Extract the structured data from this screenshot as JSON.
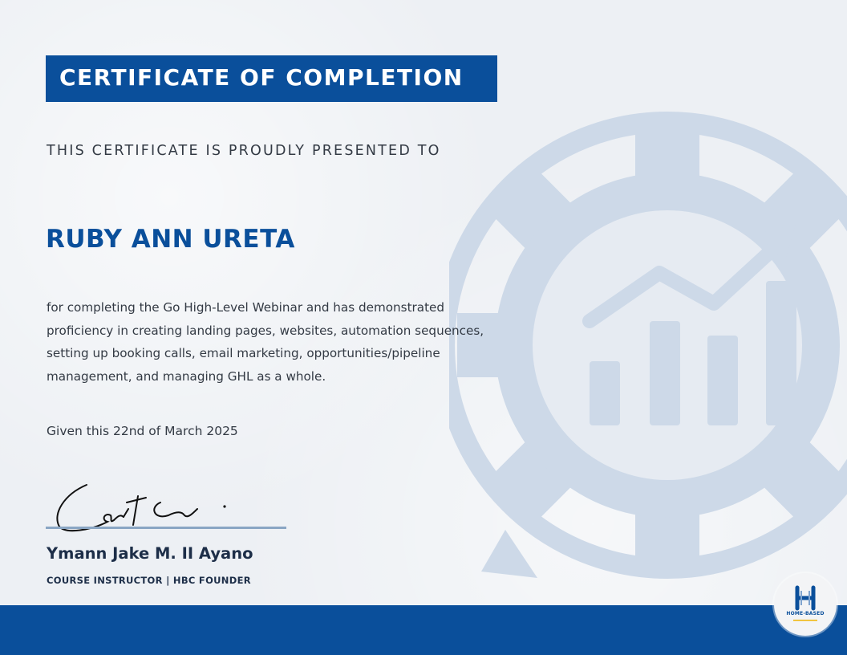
{
  "certificate": {
    "title": "CERTIFICATE OF COMPLETION",
    "presented_to": "THIS CERTIFICATE IS PROUDLY PRESENTED TO",
    "recipient": "RUBY ANN URETA",
    "description": "for completing the Go High-Level Webinar and has demonstrated proficiency in creating landing pages, websites, automation sequences, setting up booking calls, email marketing, opportunities/pipeline management, and managing GHL as a whole.",
    "given_date": "Given this 22nd of March 2025"
  },
  "signer": {
    "name": "Ymann Jake M. II Ayano",
    "role": "COURSE INSTRUCTOR | HBC FOUNDER"
  },
  "logo": {
    "text": "HOME-BASED",
    "icon": "hbc-logo-icon"
  },
  "watermark": {
    "icon": "gear-growth-chart-icon"
  },
  "colors": {
    "brand_blue": "#0a4f9b",
    "text_dark": "#333a44",
    "watermark": "#c9d6e6"
  }
}
